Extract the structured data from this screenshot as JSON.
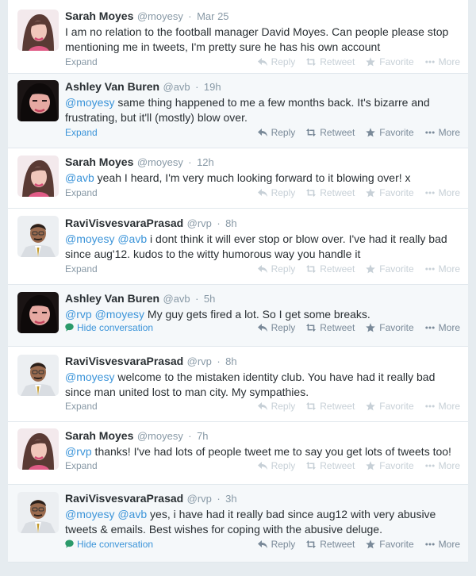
{
  "colors": {
    "link": "#3b94d9",
    "text": "#292f33",
    "muted": "#8899a6",
    "hide_icon": "#2b9a6a"
  },
  "actions": {
    "reply": "Reply",
    "retweet": "Retweet",
    "favorite": "Favorite",
    "more": "More"
  },
  "tweets": [
    {
      "name": "Sarah Moyes",
      "handle": "@moyesy",
      "time": "Mar 25",
      "avatar": "sarah-avatar",
      "line1": "I am no relation to the football manager David Moyes. Can people please stop",
      "line2": "mentioning me in tweets, I'm pretty sure he has his own account",
      "footer_link": "Expand"
    },
    {
      "name": "Ashley Van Buren",
      "handle": "@avb",
      "time": "19h",
      "avatar": "ashley-avatar",
      "mention1": "@moyesy",
      "line1": " same thing happened to me a few months back. It's bizarre and",
      "line2": "frustrating, but it'll (mostly) blow over.",
      "footer_link": "Expand"
    },
    {
      "name": "Sarah Moyes",
      "handle": "@moyesy",
      "time": "12h",
      "avatar": "sarah-avatar",
      "mention1": "@avb",
      "line1": " yeah I heard, I'm very much looking forward to it blowing over! x",
      "footer_link": "Expand"
    },
    {
      "name": "RaviVisvesvaraPrasad",
      "handle": "@rvp",
      "time": "8h",
      "avatar": "ravi-avatar",
      "mention1": "@moyesy",
      "mention2": "@avb",
      "line1": " i dont think it will ever stop or blow over. I've had it really bad",
      "line2": "since aug'12. kudos to the witty humorous way you handle it",
      "footer_link": "Expand"
    },
    {
      "name": "Ashley Van Buren",
      "handle": "@avb",
      "time": "5h",
      "avatar": "ashley-avatar",
      "mention1": "@rvp",
      "mention2": "@moyesy",
      "line1": " My guy gets fired a lot. So I get some breaks.",
      "footer_link": "Hide conversation"
    },
    {
      "name": "RaviVisvesvaraPrasad",
      "handle": "@rvp",
      "time": "8h",
      "avatar": "ravi-avatar",
      "mention1": "@moyesy",
      "line1": " welcome to the mistaken identity club. You have had it really bad",
      "line2": "since man united lost to man city. My sympathies.",
      "footer_link": "Expand"
    },
    {
      "name": "Sarah Moyes",
      "handle": "@moyesy",
      "time": "7h",
      "avatar": "sarah-avatar",
      "mention1": "@rvp",
      "line1": " thanks! I've had lots of people tweet me to say you get lots of tweets too!",
      "footer_link": "Expand"
    },
    {
      "name": "RaviVisvesvaraPrasad",
      "handle": "@rvp",
      "time": "3h",
      "avatar": "ravi-avatar",
      "mention1": "@moyesy",
      "mention2": "@avb",
      "line1": " yes, i have had it really bad since aug12 with very abusive",
      "line2": "tweets & emails. Best wishes for coping with the abusive deluge.",
      "footer_link": "Hide conversation"
    }
  ]
}
